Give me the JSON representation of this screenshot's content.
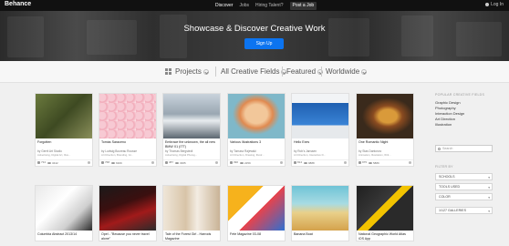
{
  "topbar": {
    "logo": "Behance",
    "nav": [
      "Discover",
      "Jobs",
      "Hiring Talent?"
    ],
    "post_job": "Post a Job",
    "login": "Log In"
  },
  "hero": {
    "title": "Showcase & Discover Creative Work",
    "signup": "Sign Up"
  },
  "filters": {
    "projects": "Projects",
    "fields": "All Creative Fields",
    "featured": "Featured",
    "worldwide": "Worldwide"
  },
  "projects": [
    {
      "title": "Forgotten",
      "author": "by Gerrit Art Studio",
      "fields": "Advertising, Digital Art, Illus...",
      "likes": "734",
      "views": "3442"
    },
    {
      "title": "Tomás Saraceno",
      "author": "by Ludwig Boureau Rousse",
      "fields": "Art Direction, Branding, Gr...",
      "likes": "768",
      "views": "6309"
    },
    {
      "title": "Embrace the unknown, the all new BMW X1 (ITT)",
      "author": "by Thomas Bergstedt",
      "fields": "Advertising, Digital Photog...",
      "likes": "387",
      "views": "3365"
    },
    {
      "title": "Various Illustrations 3",
      "author": "by Tomasz Rajewski",
      "fields": "Art Direction, Drawing, Illustr...",
      "likes": "390",
      "views": "2259"
    },
    {
      "title": "Hello Exes",
      "author": "by Rob's Janssen",
      "fields": "Art Direction, Interactive D...",
      "likes": "814",
      "views": "9888"
    },
    {
      "title": "One Romantic Night",
      "author": "by Stas Dantonov",
      "fields": "Animation, Illustration, Writ...",
      "likes": "975",
      "views": "5889"
    },
    {
      "title": "Columbia Abstract 2013/14",
      "author": "",
      "fields": "",
      "likes": "",
      "views": ""
    },
    {
      "title": "Opel - \"Because you never travel alone\"",
      "author": "",
      "fields": "",
      "likes": "",
      "views": ""
    },
    {
      "title": "Tale of the Forest Girl - Harrods Magazine",
      "author": "",
      "fields": "",
      "likes": "",
      "views": ""
    },
    {
      "title": "Fete Magazine 03-08",
      "author": "",
      "fields": "",
      "likes": "",
      "views": ""
    },
    {
      "title": "Banana Boat",
      "author": "",
      "fields": "",
      "likes": "",
      "views": ""
    },
    {
      "title": "National Geographic World Atlas iOS App",
      "author": "",
      "fields": "",
      "likes": "",
      "views": ""
    }
  ],
  "sidebar": {
    "popular_heading": "POPULAR CREATIVE FIELDS",
    "fields": [
      "Graphic Design",
      "Photography",
      "Interaction Design",
      "Art Direction",
      "Illustration"
    ],
    "search_placeholder": "Search",
    "filter_heading": "FILTER BY",
    "filters": [
      "SCHOOLS",
      "TOOLS USED",
      "COLOR",
      "1/127 GALLERIES"
    ]
  },
  "colors": {
    "topbar": "#111111",
    "signup_button": "#0c74f0",
    "content_bg": "#f0f0f0"
  }
}
